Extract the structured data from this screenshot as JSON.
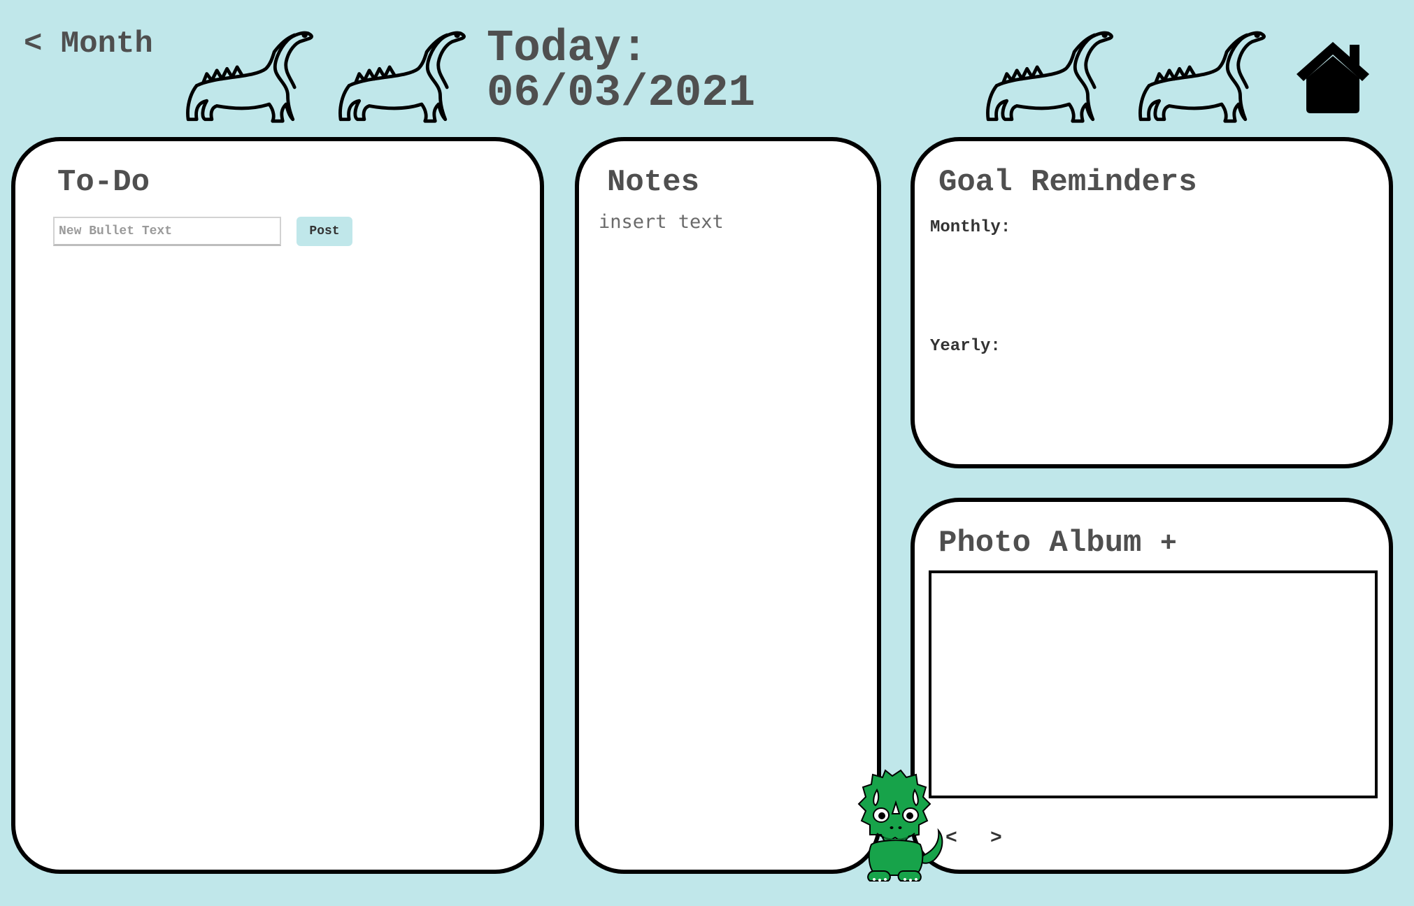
{
  "header": {
    "back_label": "< Month",
    "today_label": "Today:",
    "date": "06/03/2021"
  },
  "todo": {
    "title": "To-Do",
    "input_placeholder": "New Bullet Text",
    "post_label": "Post"
  },
  "notes": {
    "title": "Notes",
    "placeholder": "insert text"
  },
  "goals": {
    "title": "Goal Reminders",
    "monthly_label": "Monthly:",
    "yearly_label": "Yearly:"
  },
  "photo_album": {
    "title": "Photo Album",
    "add_label": "+",
    "prev_label": "<",
    "next_label": ">"
  },
  "icons": {
    "decor": "dinosaur-outline-icon",
    "home": "home-icon",
    "mascot": "triceratops-icon"
  },
  "colors": {
    "background": "#c0e7ea",
    "text": "#4f4f4f",
    "panel_border": "#000000",
    "mascot_green": "#17a34a"
  }
}
